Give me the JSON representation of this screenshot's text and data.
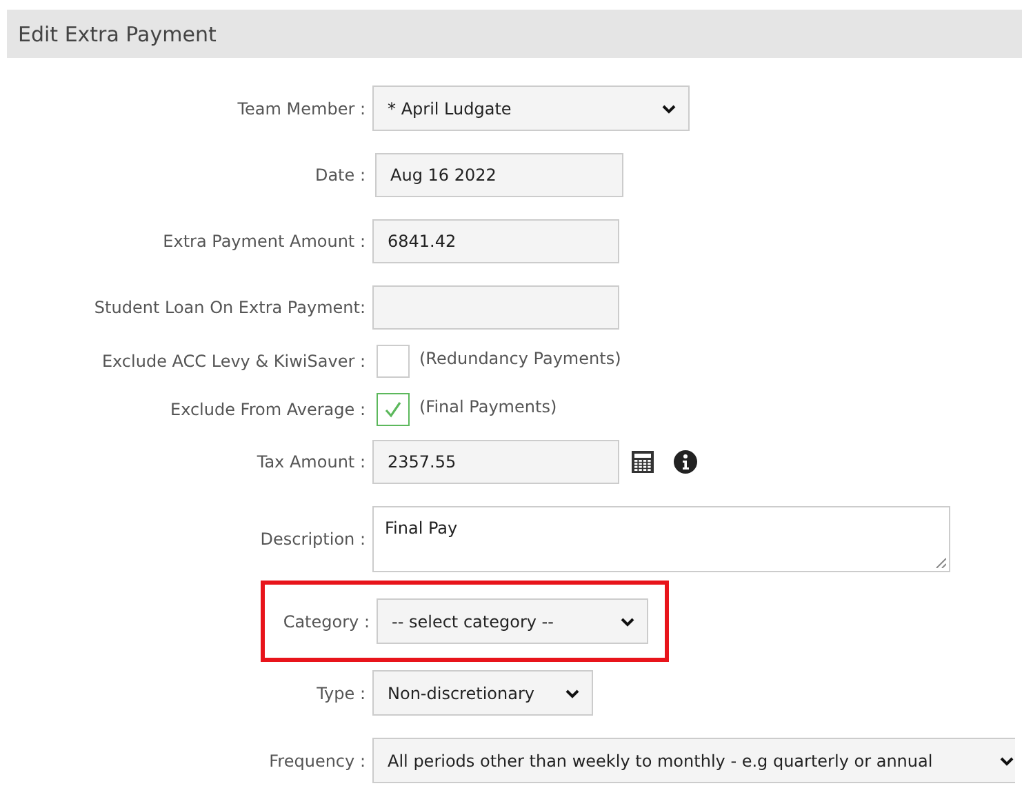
{
  "header": {
    "title": "Edit Extra Payment"
  },
  "fields": [
    {
      "kind": "select",
      "label": "Team Member :",
      "value": "* April Ludgate"
    },
    {
      "kind": "text",
      "label": "Date :",
      "value": "Aug 16 2022"
    },
    {
      "kind": "text",
      "label": "Extra Payment Amount :",
      "value": "6841.42"
    },
    {
      "kind": "text",
      "label": "Student Loan On Extra Payment:"
    },
    {
      "kind": "checkbox",
      "label": "Exclude ACC Levy & KiwiSaver :",
      "checked": false,
      "note": "(Redundancy Payments)"
    },
    {
      "kind": "checkbox",
      "label": "Exclude From Average :",
      "checked": true,
      "note": "(Final Payments)"
    },
    {
      "kind": "tax",
      "label": "Tax Amount :",
      "value": "2357.55"
    },
    {
      "kind": "textarea",
      "label": "Description :",
      "value": "Final Pay"
    },
    {
      "kind": "select",
      "label": "Category :",
      "value": "-- select category --",
      "highlighted": true
    },
    {
      "kind": "select",
      "label": "Type :",
      "value": "Non-discretionary"
    },
    {
      "kind": "select",
      "label": "Frequency :",
      "value": "All periods other than weekly to monthly - e.g quarterly or annual"
    }
  ]
}
